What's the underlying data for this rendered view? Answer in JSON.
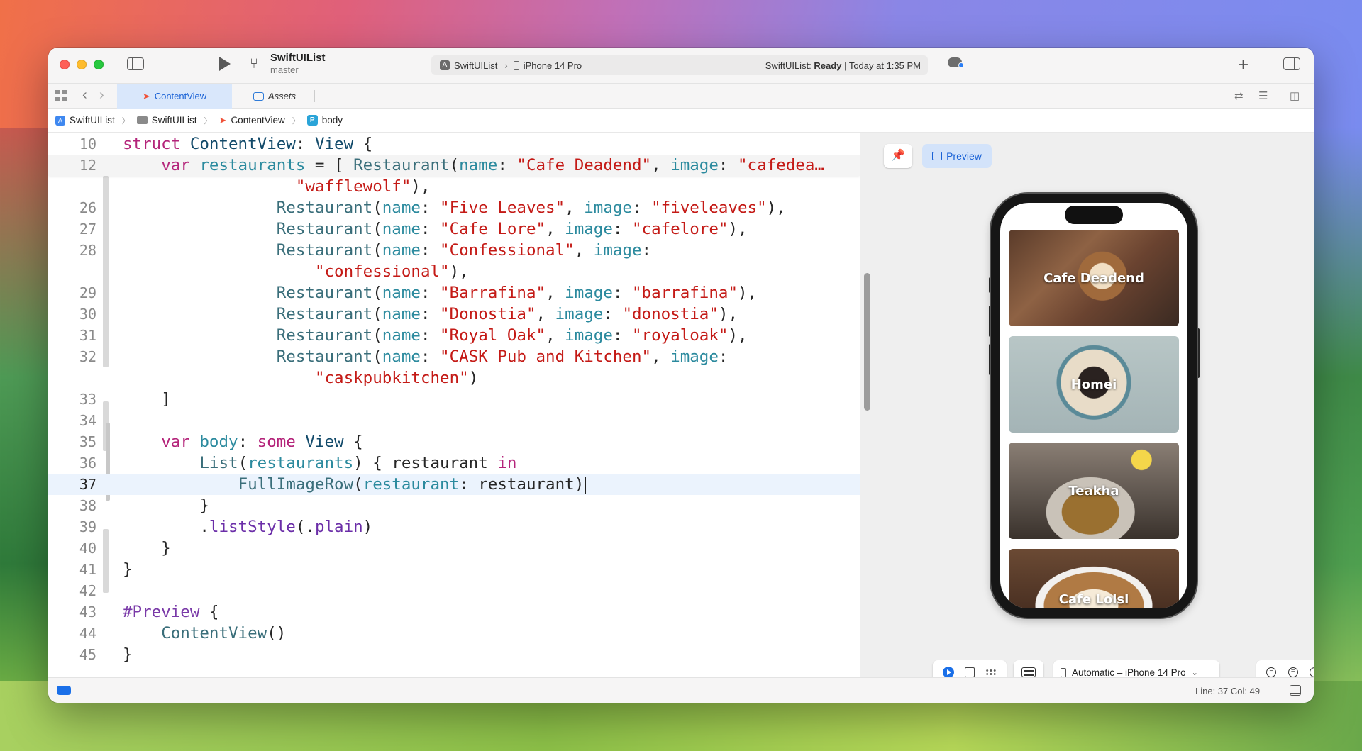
{
  "titlebar": {
    "project_name": "SwiftUIList",
    "branch": "master",
    "scheme": "SwiftUIList",
    "device": "iPhone 14 Pro",
    "status_prefix": "SwiftUIList: ",
    "status_state": "Ready",
    "status_time": "| Today at 1:35 PM"
  },
  "tabs": [
    {
      "label": "ContentView",
      "active": true
    },
    {
      "label": "Assets",
      "active": false
    }
  ],
  "breadcrumb": [
    "SwiftUIList",
    "SwiftUIList",
    "ContentView",
    "body"
  ],
  "editor": {
    "line_numbers": [
      "10",
      "12",
      "26",
      "27",
      "28",
      "29",
      "30",
      "31",
      "32",
      "33",
      "34",
      "35",
      "36",
      "37",
      "38",
      "39",
      "40",
      "41",
      "42",
      "43",
      "44",
      "45"
    ],
    "current_line": "37"
  },
  "canvas": {
    "preview_label": "Preview",
    "device_selector": "Automatic – iPhone 14 Pro",
    "restaurants": [
      {
        "name": "Cafe Deadend"
      },
      {
        "name": "Homei"
      },
      {
        "name": "Teakha"
      },
      {
        "name": "Cafe Loisl"
      }
    ]
  },
  "statusbar": {
    "cursor_position": "Line: 37  Col: 49"
  },
  "colors": {
    "accent": "#1a62d6",
    "keyword": "#b4247a",
    "string": "#c41a16"
  }
}
